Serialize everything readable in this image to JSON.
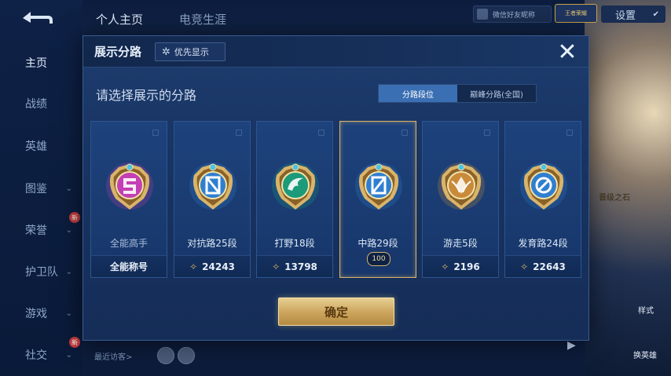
{
  "header": {
    "tabs": [
      {
        "label": "个人主页",
        "active": true
      },
      {
        "label": "电竞生涯",
        "active": false
      }
    ],
    "pill_text": "微信好友昵称",
    "badge_text": "王者荣耀",
    "settings_label": "设置"
  },
  "sidebar": {
    "items": [
      {
        "label": "主页",
        "active": true,
        "chevron": false,
        "new": false
      },
      {
        "label": "战绩",
        "active": false,
        "chevron": false,
        "new": false
      },
      {
        "label": "英雄",
        "active": false,
        "chevron": false,
        "new": false
      },
      {
        "label": "图鉴",
        "active": false,
        "chevron": true,
        "new": false
      },
      {
        "label": "荣誉",
        "active": false,
        "chevron": true,
        "new": true
      },
      {
        "label": "护卫队",
        "active": false,
        "chevron": true,
        "new": false
      },
      {
        "label": "游戏",
        "active": false,
        "chevron": true,
        "new": false
      },
      {
        "label": "社交",
        "active": false,
        "chevron": true,
        "new": true
      }
    ],
    "new_badge": "新"
  },
  "background": {
    "visitors_label": "最近访客>",
    "right_label_1": "晋级之石",
    "right_label_2": "换英雄",
    "right_label_3": "样式"
  },
  "modal": {
    "title": "展示分路",
    "priority_label": "优先显示",
    "close_icon": "close-icon",
    "subtitle": "请选择展示的分路",
    "toggle": [
      {
        "label": "分路段位",
        "on": true
      },
      {
        "label": "巅峰分路(全国)",
        "on": false
      }
    ],
    "cards": [
      {
        "name": "全能高手",
        "footer": "全能称号",
        "points": null,
        "selected": false,
        "emblem_color": "#c43fb3",
        "emblem_glyph": "allround"
      },
      {
        "name": "对抗路25段",
        "footer": "24243",
        "points": true,
        "selected": false,
        "emblem_color": "#2f7fd1",
        "emblem_glyph": "clash"
      },
      {
        "name": "打野18段",
        "footer": "13798",
        "points": true,
        "selected": false,
        "emblem_color": "#1c9a7a",
        "emblem_glyph": "jungle"
      },
      {
        "name": "中路29段",
        "footer": "",
        "points": false,
        "selected": true,
        "emblem_color": "#2f7fd1",
        "emblem_glyph": "mid",
        "badge": "100"
      },
      {
        "name": "游走5段",
        "footer": "2196",
        "points": true,
        "selected": false,
        "emblem_color": "#c98a3a",
        "emblem_glyph": "roam"
      },
      {
        "name": "发育路24段",
        "footer": "22643",
        "points": true,
        "selected": false,
        "emblem_color": "#2f7fd1",
        "emblem_glyph": "farm"
      }
    ],
    "confirm_label": "确定"
  },
  "colors": {
    "accent_gold": "#d9b46a",
    "toggle_on": "#3b6fb3",
    "modal_bg": "#183463"
  }
}
